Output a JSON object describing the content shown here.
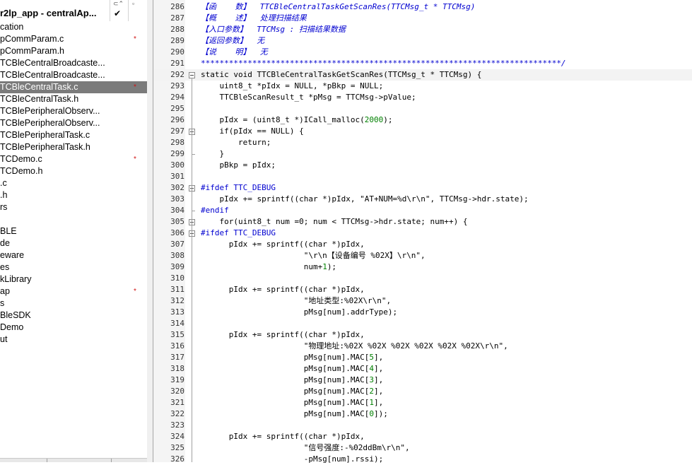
{
  "project": {
    "title": "r2lp_app - centralAp...",
    "check": "✔",
    "tree": [
      {
        "label": "cation",
        "mark": ""
      },
      {
        "label": "pCommParam.c",
        "mark": "*"
      },
      {
        "label": "pCommParam.h",
        "mark": ""
      },
      {
        "label": "TCBleCentralBroadcaste...",
        "mark": ""
      },
      {
        "label": "TCBleCentralBroadcaste...",
        "mark": ""
      },
      {
        "label": "TCBleCentralTask.c",
        "mark": "*",
        "selected": true
      },
      {
        "label": "TCBleCentralTask.h",
        "mark": ""
      },
      {
        "label": "TCBlePeripheralObserv...",
        "mark": ""
      },
      {
        "label": "TCBlePeripheralObserv...",
        "mark": ""
      },
      {
        "label": "TCBlePeripheralTask.c",
        "mark": ""
      },
      {
        "label": "TCBlePeripheralTask.h",
        "mark": ""
      },
      {
        "label": "TCDemo.c",
        "mark": "*"
      },
      {
        "label": "TCDemo.h",
        "mark": ""
      },
      {
        "label": ".c",
        "mark": ""
      },
      {
        "label": ".h",
        "mark": ""
      },
      {
        "label": "rs",
        "mark": ""
      },
      {
        "label": "",
        "mark": ""
      },
      {
        "label": "BLE",
        "mark": ""
      },
      {
        "label": "de",
        "mark": ""
      },
      {
        "label": "eware",
        "mark": ""
      },
      {
        "label": "es",
        "mark": ""
      },
      {
        "label": "kLibrary",
        "mark": ""
      },
      {
        "label": "ap",
        "mark": "*"
      },
      {
        "label": "s",
        "mark": ""
      },
      {
        "label": "BleSDK",
        "mark": ""
      },
      {
        "label": "Demo",
        "mark": ""
      },
      {
        "label": "ut",
        "mark": ""
      }
    ]
  },
  "editor": {
    "lines": [
      {
        "n": "286",
        "t": "【函    数】  TTCBleCentralTaskGetScanRes(TTCMsg_t * TTCMsg)",
        "c": "cm"
      },
      {
        "n": "287",
        "t": "【概    述】  处理扫描结果",
        "c": "cm"
      },
      {
        "n": "288",
        "t": "【入口参数】  TTCMsg : 扫描结果数据",
        "c": "cm"
      },
      {
        "n": "289",
        "t": "【返回参数】  无",
        "c": "cm"
      },
      {
        "n": "290",
        "t": "【说    明】  无",
        "c": "cm"
      },
      {
        "n": "291",
        "t": "*****************************************************************************/",
        "c": "cm"
      },
      {
        "n": "292",
        "t": "static void TTCBleCentralTaskGetScanRes(TTCMsg_t * TTCMsg) {",
        "c": "kw",
        "fold": true,
        "hl": true
      },
      {
        "n": "293",
        "t": "    uint8_t *pIdx = NULL, *pBkp = NULL;",
        "c": "kw"
      },
      {
        "n": "294",
        "t": "    TTCBleScanResult_t *pMsg = TTCMsg->pValue;",
        "c": "kw"
      },
      {
        "n": "295",
        "t": "",
        "c": "kw"
      },
      {
        "n": "296",
        "t": "    pIdx = (uint8_t *)ICall_malloc(2000);",
        "c": "kw"
      },
      {
        "n": "297",
        "t": "    if(pIdx == NULL) {",
        "c": "kw",
        "fold": true
      },
      {
        "n": "298",
        "t": "        return;",
        "c": "kw"
      },
      {
        "n": "299",
        "t": "    }",
        "c": "kw"
      },
      {
        "n": "300",
        "t": "    pBkp = pIdx;",
        "c": "kw"
      },
      {
        "n": "301",
        "t": "",
        "c": "kw"
      },
      {
        "n": "302",
        "t": "#ifdef TTC_DEBUG",
        "c": "pp",
        "fold": true
      },
      {
        "n": "303",
        "t": "    pIdx += sprintf((char *)pIdx, \"AT+NUM=%d\\r\\n\", TTCMsg->hdr.state);",
        "c": "kw"
      },
      {
        "n": "304",
        "t": "#endif",
        "c": "pp"
      },
      {
        "n": "305",
        "t": "    for(uint8_t num =0; num < TTCMsg->hdr.state; num++) {",
        "c": "kw",
        "fold": true
      },
      {
        "n": "306",
        "t": "#ifdef TTC_DEBUG",
        "c": "pp",
        "fold": true
      },
      {
        "n": "307",
        "t": "      pIdx += sprintf((char *)pIdx,",
        "c": "kw"
      },
      {
        "n": "308",
        "t": "                      \"\\r\\n【设备编号 %02X】\\r\\n\",",
        "c": "kw"
      },
      {
        "n": "309",
        "t": "                      num+1);",
        "c": "kw"
      },
      {
        "n": "310",
        "t": "",
        "c": "kw"
      },
      {
        "n": "311",
        "t": "      pIdx += sprintf((char *)pIdx,",
        "c": "kw"
      },
      {
        "n": "312",
        "t": "                      \"地址类型:%02X\\r\\n\",",
        "c": "kw"
      },
      {
        "n": "313",
        "t": "                      pMsg[num].addrType);",
        "c": "kw"
      },
      {
        "n": "314",
        "t": "",
        "c": "kw"
      },
      {
        "n": "315",
        "t": "      pIdx += sprintf((char *)pIdx,",
        "c": "kw"
      },
      {
        "n": "316",
        "t": "                      \"物理地址:%02X %02X %02X %02X %02X %02X\\r\\n\",",
        "c": "kw"
      },
      {
        "n": "317",
        "t": "                      pMsg[num].MAC[5],",
        "c": "kw"
      },
      {
        "n": "318",
        "t": "                      pMsg[num].MAC[4],",
        "c": "kw"
      },
      {
        "n": "319",
        "t": "                      pMsg[num].MAC[3],",
        "c": "kw"
      },
      {
        "n": "320",
        "t": "                      pMsg[num].MAC[2],",
        "c": "kw"
      },
      {
        "n": "321",
        "t": "                      pMsg[num].MAC[1],",
        "c": "kw"
      },
      {
        "n": "322",
        "t": "                      pMsg[num].MAC[0]);",
        "c": "kw"
      },
      {
        "n": "323",
        "t": "",
        "c": "kw"
      },
      {
        "n": "324",
        "t": "      pIdx += sprintf((char *)pIdx,",
        "c": "kw"
      },
      {
        "n": "325",
        "t": "                      \"信号强度:-%02ddBm\\r\\n\",",
        "c": "kw"
      },
      {
        "n": "326",
        "t": "                      -pMsg[num].rssi);",
        "c": "kw"
      }
    ]
  }
}
